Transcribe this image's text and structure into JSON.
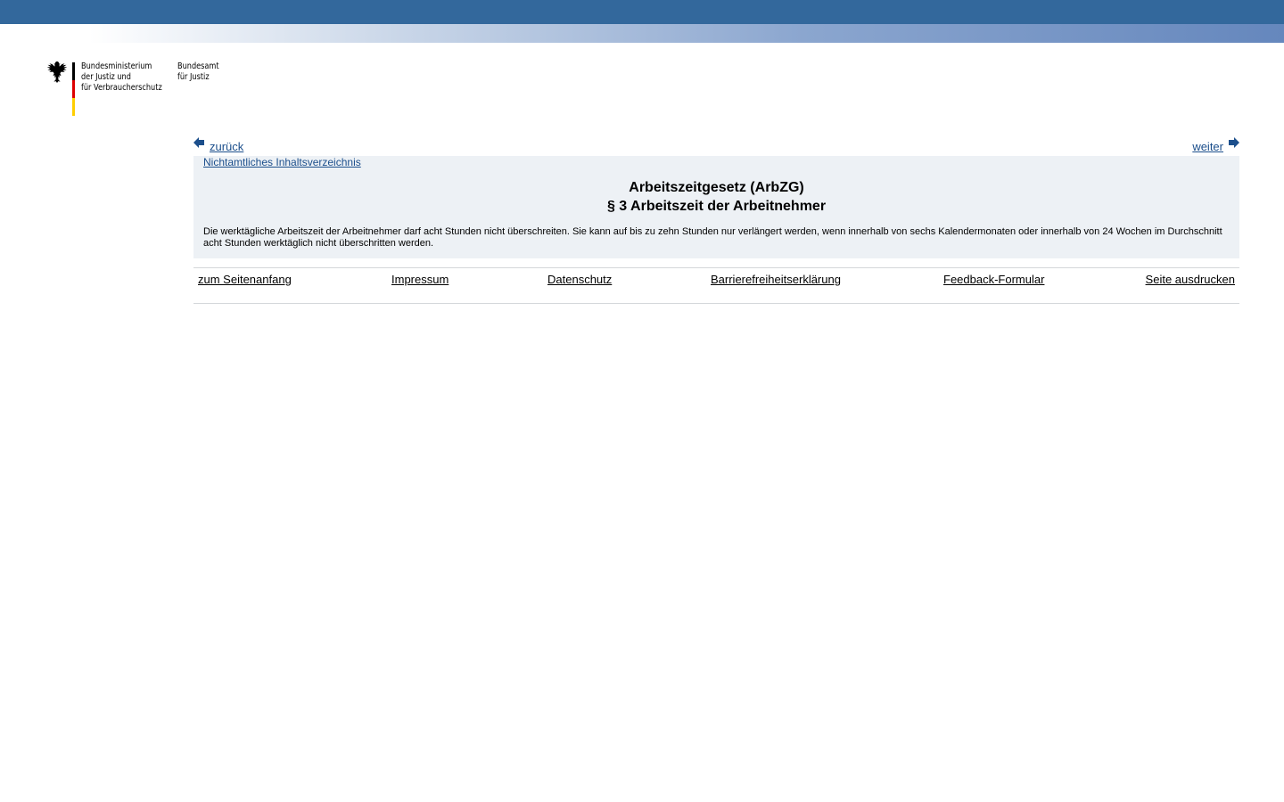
{
  "header": {
    "ministry_lines": [
      "Bundesministerium",
      "der Justiz und",
      "für Verbraucherschutz"
    ],
    "office_lines": [
      "Bundesamt",
      "für Justiz"
    ]
  },
  "nav": {
    "back_label": "zurück",
    "next_label": "weiter"
  },
  "content": {
    "toc_link": "Nichtamtliches Inhaltsverzeichnis",
    "law_title": "Arbeitszeitgesetz (ArbZG)",
    "section_title": "§ 3 Arbeitszeit der Arbeitnehmer",
    "body": "Die werktägliche Arbeitszeit der Arbeitnehmer darf acht Stunden nicht überschreiten. Sie kann auf bis zu zehn Stunden nur verlängert werden, wenn innerhalb von sechs Kalendermonaten oder innerhalb von 24 Wochen im Durchschnitt acht Stunden werktäglich nicht überschritten werden."
  },
  "footer": {
    "links": [
      "zum Seitenanfang",
      "Impressum",
      "Datenschutz",
      "Barrierefreiheitserklärung",
      "Feedback-Formular",
      "Seite ausdrucken"
    ]
  },
  "colors": {
    "top_bar": "#33689c",
    "link": "#1c4f8c",
    "content_bg": "#edf1f5"
  }
}
